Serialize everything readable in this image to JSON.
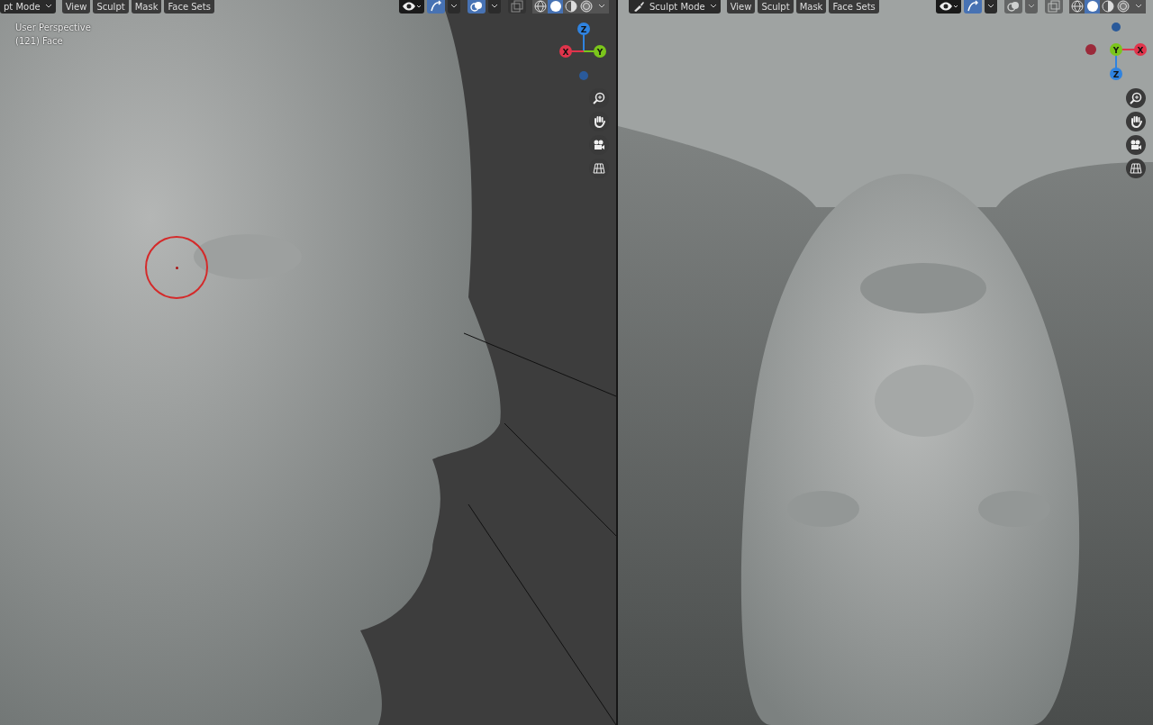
{
  "viewports": [
    {
      "mode_label": "pt Mode",
      "mode_icon": false,
      "menus": [
        "View",
        "Sculpt",
        "Mask",
        "Face Sets"
      ],
      "overlay_text": [
        "User Perspective",
        "(121) Face"
      ],
      "visibility_on": true,
      "gizmos_on": true,
      "overlays_on": true,
      "xray_on": false,
      "shading": [
        {
          "selected": false
        },
        {
          "selected": true
        },
        {
          "selected": false
        },
        {
          "selected": false
        }
      ],
      "gizmo": {
        "kind": "side",
        "x": "X",
        "y": "Y",
        "z": "Z"
      },
      "brush_cursor": true
    },
    {
      "mode_label": "Sculpt Mode",
      "mode_icon": true,
      "menus": [
        "View",
        "Sculpt",
        "Mask",
        "Face Sets"
      ],
      "visibility_on": true,
      "gizmos_on": true,
      "overlays_on": false,
      "xray_on": false,
      "shading": [
        {
          "selected": false
        },
        {
          "selected": true
        },
        {
          "selected": false
        },
        {
          "selected": false
        }
      ],
      "gizmo": {
        "kind": "bottom",
        "x": "X",
        "y": "Y",
        "z": "Z"
      },
      "brush_cursor": false
    }
  ]
}
